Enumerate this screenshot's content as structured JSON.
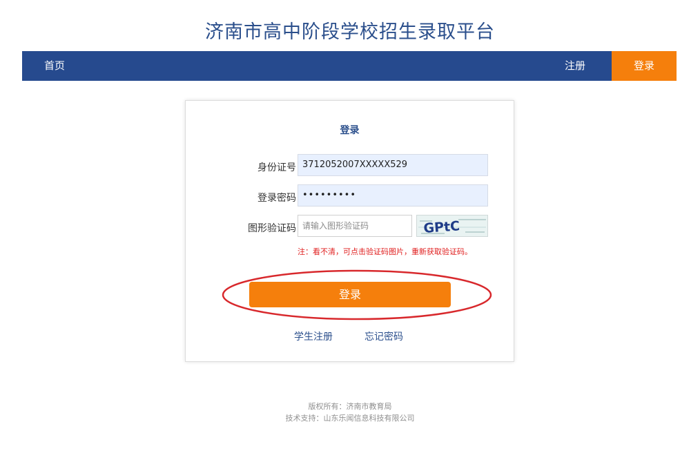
{
  "site": {
    "title": "济南市高中阶段学校招生录取平台"
  },
  "nav": {
    "home": "首页",
    "register": "注册",
    "login": "登录"
  },
  "login_form": {
    "title": "登录",
    "id_label": "身份证号",
    "id_value": "3712052007XXXXX529",
    "password_label": "登录密码",
    "password_value": "•••••••••",
    "captcha_label": "图形验证码",
    "captcha_placeholder": "请输入图形验证码",
    "captcha_text": "GPtC",
    "hint": "注：看不清，可点击验证码图片，重新获取验证码。",
    "submit": "登录",
    "student_register": "学生注册",
    "forgot_password": "忘记密码"
  },
  "footer": {
    "copyright": "版权所有：济南市教育局",
    "support": "技术支持：山东乐闻信息科技有限公司"
  },
  "colors": {
    "nav_bg": "#264a8e",
    "accent_orange": "#f57f0c",
    "annotation_red": "#d8282c"
  }
}
